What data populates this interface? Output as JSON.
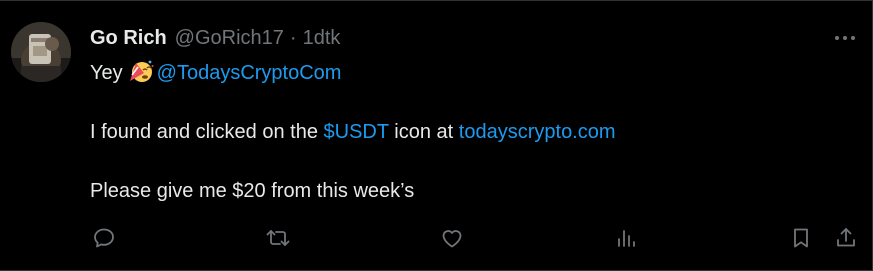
{
  "author": {
    "name": "Go Rich",
    "handle": "@GoRich17",
    "separator": "·",
    "time": "1dtk"
  },
  "body": {
    "line1_text": "Yey",
    "line1_emoji": "partying-face-emoji",
    "mention": "@TodaysCryptoCom",
    "line2_prefix": "I found and clicked on the",
    "cashtag": "$USDT",
    "line2_middle": "icon at",
    "site_link": "todayscrypto.com",
    "line3_text": "Please give me $20 from this week’s"
  },
  "icons": {
    "more": "more-dots-icon",
    "reply": "reply-icon",
    "repost": "repost-icon",
    "like": "like-icon",
    "views": "views-icon",
    "bookmark": "bookmark-icon",
    "share": "share-icon"
  },
  "colors": {
    "background": "#000000",
    "text": "#e7e9ea",
    "muted": "#71767b",
    "link": "#1d9bf0",
    "border": "#2f3336"
  }
}
